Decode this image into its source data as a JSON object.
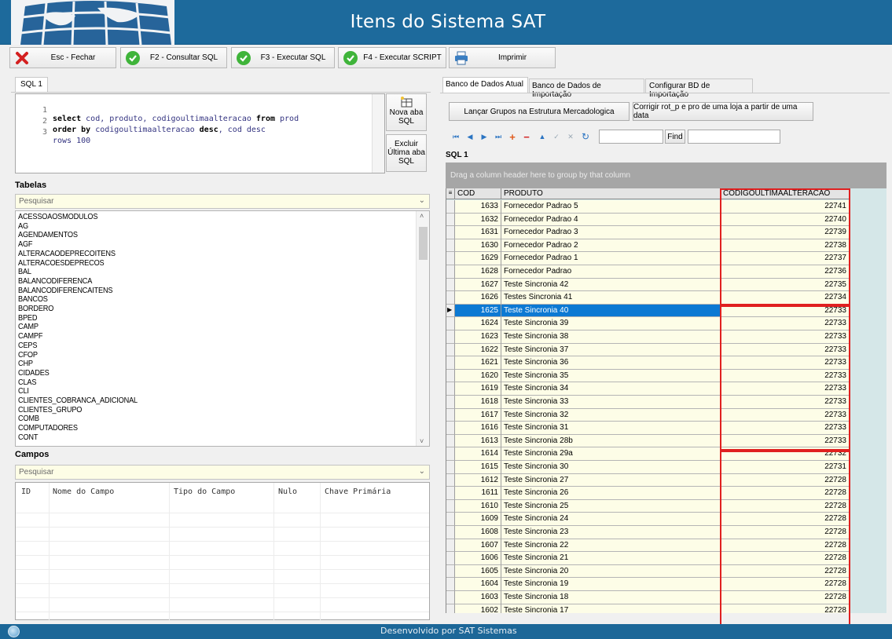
{
  "header": {
    "title": "Itens do Sistema SAT"
  },
  "toolbar": {
    "close": "Esc - Fechar",
    "consult": "F2 - Consultar SQL",
    "execute": "F3 - Executar SQL",
    "script": "F4 - Executar SCRIPT",
    "print": "Imprimir"
  },
  "sql_tabs": [
    "SQL 1"
  ],
  "editor": {
    "lines": [
      {
        "num": "1",
        "pre": "select ",
        "kw1": "",
        "rest": "cod, produto, codigoultimaalteracao ",
        "kw2": "from",
        "tail": " prod"
      },
      {
        "num": "2",
        "pre": "",
        "kw1": "order by",
        "rest": " codigoultimaalteracao ",
        "kw2": "desc",
        "tail": ", cod desc"
      },
      {
        "num": "3",
        "pre": "rows 100",
        "kw1": "",
        "rest": "",
        "kw2": "",
        "tail": ""
      }
    ]
  },
  "side_buttons": {
    "new_tab": "Nova aba SQL",
    "delete_tab": "Excluir Última aba SQL"
  },
  "tables": {
    "label": "Tabelas",
    "search_placeholder": "Pesquisar",
    "items": [
      "ACESSOAOSMODULOS",
      "AG",
      "AGENDAMENTOS",
      "AGF",
      "ALTERACAODEPRECOITENS",
      "ALTERACOESDEPRECOS",
      "BAL",
      "BALANCODIFERENCA",
      "BALANCODIFERENCAITENS",
      "BANCOS",
      "BORDERO",
      "BPED",
      "CAMP",
      "CAMPF",
      "CEPS",
      "CFOP",
      "CHP",
      "CIDADES",
      "CLAS",
      "CLI",
      "CLIENTES_COBRANCA_ADICIONAL",
      "CLIENTES_GRUPO",
      "COMB",
      "COMPUTADORES",
      "CONT"
    ]
  },
  "fields": {
    "label": "Campos",
    "search_placeholder": "Pesquisar",
    "columns": [
      "ID",
      "Nome do Campo",
      "Tipo do Campo",
      "Nulo",
      "Chave Primária"
    ]
  },
  "right_tabs": [
    "Banco de Dados Atual",
    "Banco de Dados de Importação",
    "Configurar BD de Importação"
  ],
  "right_buttons": {
    "launch_groups": "Lançar Grupos na Estrutura Mercadologica",
    "fix_rot": "Corrigir rot_p e pro de uma loja a partir de uma data"
  },
  "find_label": "Find",
  "result_title": "SQL 1",
  "group_hint": "Drag a column header here to group by that column",
  "grid": {
    "columns": [
      "COD",
      "PRODUTO",
      "CODIGOULTIMAALTERACAO"
    ],
    "rows": [
      [
        "1633",
        "Fornecedor Padrao 5",
        "22741"
      ],
      [
        "1632",
        "Fornecedor Padrao 4",
        "22740"
      ],
      [
        "1631",
        "Fornecedor Padrao 3",
        "22739"
      ],
      [
        "1630",
        "Fornecedor Padrao 2",
        "22738"
      ],
      [
        "1629",
        "Fornecedor Padrao 1",
        "22737"
      ],
      [
        "1628",
        "Fornecedor Padrao",
        "22736"
      ],
      [
        "1627",
        "Teste Sincronia 42",
        "22735"
      ],
      [
        "1626",
        "Testes Sincronia 41",
        "22734"
      ],
      [
        "1625",
        "Teste Sincronia 40",
        "22733"
      ],
      [
        "1624",
        "Teste Sincronia 39",
        "22733"
      ],
      [
        "1623",
        "Teste Sincronia 38",
        "22733"
      ],
      [
        "1622",
        "Teste Sincronia 37",
        "22733"
      ],
      [
        "1621",
        "Teste Sincronia 36",
        "22733"
      ],
      [
        "1620",
        "Teste Sincronia 35",
        "22733"
      ],
      [
        "1619",
        "Teste Sincronia 34",
        "22733"
      ],
      [
        "1618",
        "Teste Sincronia 33",
        "22733"
      ],
      [
        "1617",
        "Teste Sincronia 32",
        "22733"
      ],
      [
        "1616",
        "Teste Sincronia 31",
        "22733"
      ],
      [
        "1613",
        "Teste Sincronia 28b",
        "22733"
      ],
      [
        "1614",
        "Teste Sincronia 29a",
        "22732"
      ],
      [
        "1615",
        "Teste Sincronia 30",
        "22731"
      ],
      [
        "1612",
        "Teste Sincronia 27",
        "22728"
      ],
      [
        "1611",
        "Teste Sincronia 26",
        "22728"
      ],
      [
        "1610",
        "Teste Sincronia 25",
        "22728"
      ],
      [
        "1609",
        "Teste Sincronia 24",
        "22728"
      ],
      [
        "1608",
        "Teste Sincronia 23",
        "22728"
      ],
      [
        "1607",
        "Teste Sincronia 22",
        "22728"
      ],
      [
        "1606",
        "Teste Sincronia 21",
        "22728"
      ],
      [
        "1605",
        "Teste Sincronia 20",
        "22728"
      ],
      [
        "1604",
        "Teste Sincronia 19",
        "22728"
      ],
      [
        "1603",
        "Teste Sincronia 18",
        "22728"
      ],
      [
        "1602",
        "Teste Sincronia 17",
        "22728"
      ]
    ],
    "selected_row": 8
  },
  "footer": {
    "text": "Desenvolvido por SAT Sistemas"
  },
  "colors": {
    "header": "#1d6a9c",
    "accent": "#0c79d3",
    "highlight": "#e02020",
    "cell": "#fdfde7"
  }
}
